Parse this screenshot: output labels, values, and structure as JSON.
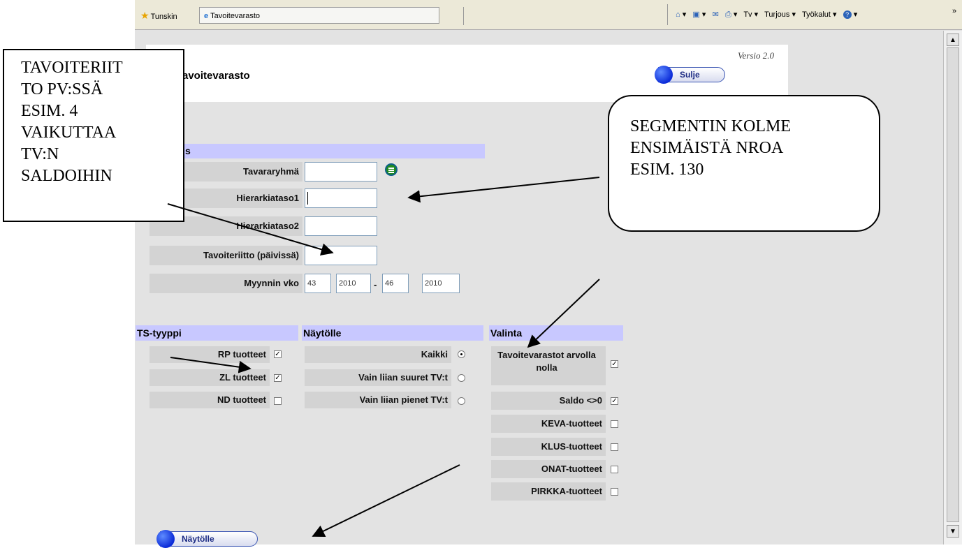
{
  "browser": {
    "favorites_label": "Tunskin",
    "tab_title": "Tavoitevarasto",
    "command_bar": [
      "Tv",
      "Turjous",
      "Työkalut"
    ],
    "more_label": "»"
  },
  "app": {
    "version": "Versio 2.0",
    "title": "avoitevarasto",
    "close_button": "Sulje",
    "section_label": "s",
    "fields": {
      "tavararyhma_label": "Tavararyhmä",
      "hierarkiataso1_label": "Hierarkiataso1",
      "hierarkiataso2_label": "Hierarkiataso2",
      "tavoiteriitto_label": "Tavoiteriitto (päivissä)",
      "myynnin_vko_label": "Myynnin vko",
      "week_from": "43",
      "year_from": "2010",
      "week_to": "46",
      "year_to": "2010",
      "range_separator": "-"
    },
    "ts_tyyppi": {
      "header": "TS-tyyppi",
      "items": [
        {
          "label": "RP tuotteet",
          "checked": true
        },
        {
          "label": "ZL tuotteet",
          "checked": true
        },
        {
          "label": "ND tuotteet",
          "checked": false
        }
      ]
    },
    "naytolle_options": {
      "header": "Näytölle",
      "items": [
        {
          "label": "Kaikki",
          "selected": true
        },
        {
          "label": "Vain liian suuret TV:t",
          "selected": false
        },
        {
          "label": "Vain liian pienet TV:t",
          "selected": false
        }
      ]
    },
    "valinta": {
      "header": "Valinta",
      "items": [
        {
          "label": "Tavoitevarastot arvolla nolla",
          "checked": true
        },
        {
          "label": "Saldo <>0",
          "checked": true
        },
        {
          "label": "KEVA-tuotteet",
          "checked": false
        },
        {
          "label": "KLUS-tuotteet",
          "checked": false
        },
        {
          "label": "ONAT-tuotteet",
          "checked": false
        },
        {
          "label": "PIRKKA-tuotteet",
          "checked": false
        }
      ]
    },
    "submit_button": "Näytölle"
  },
  "annotations": {
    "note1": "TAVOITERIIT\nTO PV:SSÄ\nESIM. 4\nVAIKUTTAA\nTV:N\nSALDOIHIN",
    "note2": "SEGMENTIN KOLME\nENSIMÄISTÄ NROA\nESIM. 130"
  },
  "colors": {
    "section_bar": "#c8c8ff",
    "label_bg": "#d3d3d3",
    "page_bg": "#e3e3e3",
    "button_dot": "#0b2bd8"
  }
}
